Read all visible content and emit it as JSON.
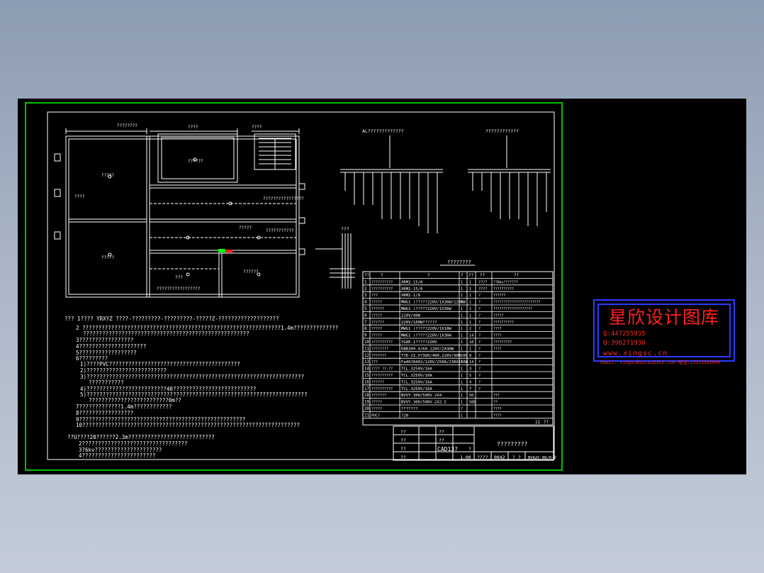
{
  "colors": {
    "background": "#000000",
    "line": "#ffffff",
    "outer_border": "#00ff00",
    "stamp_border": "#2a3cff",
    "stamp_text": "#ff2020"
  },
  "floor_plan": {
    "rooms": [
      "?????",
      "?????",
      "??????",
      "?????",
      "??????",
      "???",
      "????????"
    ],
    "dimensions": [
      "????",
      "????",
      "????"
    ],
    "corridor_labels": [
      "????????????????",
      "?????????????????"
    ],
    "notes_legend": "???????????"
  },
  "distribution": {
    "diagram_left_title": "AL?????????????",
    "diagram_right_title": "????????????",
    "lower_label": "???"
  },
  "notes": {
    "main": [
      "??? 1???? YRXYZ ????-?????????-?????????-?????Z-???????????????????",
      "2 ??????????????????????????????????????????????????????????????1.4m??????????????",
      "????????????????????????????????????????????????????",
      "3?????????????????",
      "4?????????????????????",
      "5??????????????????",
      "6?????????",
      "1)????PVC?????????????????????????????????????????",
      "2)?????????????????????????",
      "3)????????????????????????????????????????????????????????????????????",
      "???????????",
      "4)?????????????????????????40??????????????????????????",
      "5)?????????????????????????????????????????????????????????????????????",
      "?????????????????????????0m??",
      "7?????????????1.4m????????????",
      "8?????????????????",
      "9????????????????????????????????????????????????????",
      "10????????????????????????????????????????????????????????????????????"
    ],
    "lower": [
      "??U????20??????2.3m???????????????????????????",
      "2?????????????????????????????????",
      "3?6kv?????????????????????",
      "4???????????????????????"
    ]
  },
  "material_table": {
    "title": "????????",
    "headers": [
      "??",
      "?",
      "?",
      "?",
      "??",
      "??",
      "??",
      "?"
    ],
    "rows": [
      [
        "1",
        "??????????",
        "XRM2-15/0",
        "1",
        "1",
        "????",
        "??6kv???????"
      ],
      [
        "2",
        "??????????",
        "XRM2-15/0",
        "1",
        "1",
        "????",
        "??????????"
      ],
      [
        "3",
        "???",
        "XRM2-1/0",
        "1",
        "1",
        "?",
        "??????"
      ],
      [
        "4",
        "?????",
        "MWG1 (?????220V/1X36W/1200W",
        "1",
        "1",
        "?",
        "???????????????????????"
      ],
      [
        "5",
        "??????",
        "MWG1 (?????220V/1X36W",
        "1",
        "1",
        "?",
        "???????????????????"
      ],
      [
        "6",
        "?????",
        "220V/40W",
        "1",
        "1",
        "?",
        "?????"
      ],
      [
        "7",
        "??????",
        "220V/100W??????",
        "1",
        "1",
        "?",
        "??????????"
      ],
      [
        "8",
        "?????",
        "MWG1 (?????220V/1X18W",
        "1",
        "2",
        "?",
        "????"
      ],
      [
        "9",
        "?????",
        "MWG1 (?????220V/1X36W",
        "1",
        "14",
        "?",
        "????"
      ],
      [
        "10",
        "??????????",
        "YG8E-1?????220V",
        "1",
        "10",
        "?",
        "?????????"
      ],
      [
        "11",
        "????????",
        "DBB309-4/60.220V/2X40W",
        "1",
        "1",
        "?",
        "????"
      ],
      [
        "12",
        "???????",
        "TYD-II.V?360/400.220V/90W",
        "100",
        "9",
        "?",
        ""
      ],
      [
        "13",
        "???",
        "Fa40J0402/120V/250A/230X150W",
        "1",
        "14",
        "?",
        ""
      ],
      [
        "14",
        "???? ??.??",
        "TCL.3250V/16A",
        "1",
        "3",
        "?",
        ""
      ],
      [
        "15",
        "??????????",
        "TCL.3250V/10A",
        "1",
        "5",
        "?",
        ""
      ],
      [
        "16",
        "??????",
        "TCL.3250V/16A",
        "1",
        "4",
        "?",
        ""
      ],
      [
        "17",
        "??????????",
        "TCL.3250V/16A",
        "1",
        "7",
        "?",
        ""
      ],
      [
        "18",
        "???????",
        "BVVY-300/500V-2X4",
        "1",
        "50",
        "",
        "???"
      ],
      [
        "19",
        "?????",
        "BVVY-300/500V-2X2.5",
        "1",
        "500",
        "",
        "??"
      ],
      [
        "20",
        "?????",
        "???????",
        "?",
        "",
        "",
        "????"
      ],
      [
        "21",
        "PVC?",
        "?20",
        "1",
        "",
        "",
        "????"
      ]
    ],
    "footer_cells": [
      "11",
      "??"
    ]
  },
  "title_block": {
    "drawing_name": "?????????",
    "left_labels": [
      "??",
      "??",
      "??",
      "??"
    ],
    "mid_labels": [
      "??",
      "??",
      "??",
      "??"
    ],
    "cad_label": "CAD13?",
    "q_mark": "?",
    "bottom": [
      "1.00",
      "????",
      "0042",
      "? ?",
      "BVA2C-00/0-0"
    ]
  },
  "watermark": {
    "title": "星欣设计图库",
    "qq1": "Q:447255935",
    "qq2": "Q:396271936",
    "web": "www.xingsc.cn",
    "contact": "Email: xingximsucai@163.com  电话:13111542600"
  }
}
